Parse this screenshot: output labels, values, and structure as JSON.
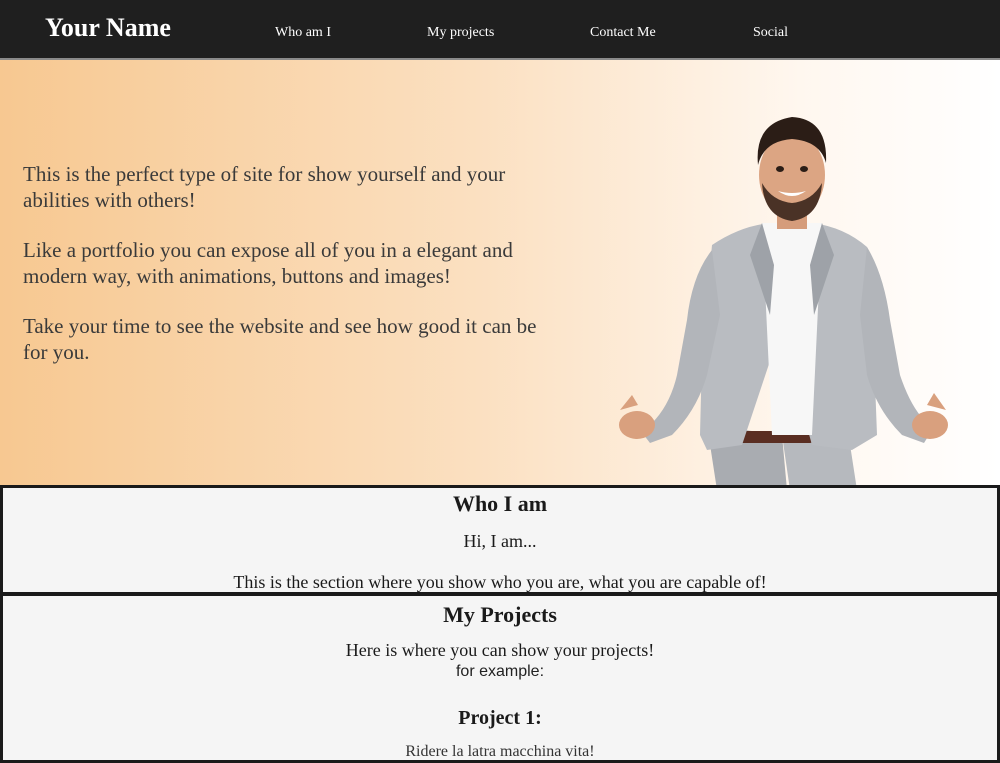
{
  "header": {
    "brand": "Your Name",
    "nav": [
      {
        "label": "Who am I"
      },
      {
        "label": "My projects"
      },
      {
        "label": "Contact Me"
      },
      {
        "label": "Social"
      }
    ]
  },
  "hero": {
    "paragraphs": [
      "This is the perfect type of site for show yourself and your abilities with others!",
      "Like a portfolio you can expose all of you in a elegant and modern way, with animations, buttons and images!",
      "Take your time to see the website and see how good it can be for you."
    ],
    "image_subject": "smiling-man-in-grey-suit"
  },
  "about": {
    "title": "Who I am",
    "greeting": "Hi, I am...",
    "description": "This is the section where you show who you are, what you are capable of!"
  },
  "projects": {
    "title": "My Projects",
    "intro": "Here is where you can show your projects!",
    "example_label": "for example:",
    "project_1_title": "Project 1:",
    "project_1_text": "Ridere la latra macchina vita!"
  },
  "colors": {
    "nav_bg": "#1f1f1f",
    "hero_gradient_start": "#f7c891",
    "hero_gradient_end": "#ffffff",
    "section_bg": "#f5f5f5",
    "section_border": "#1a1a1a"
  }
}
